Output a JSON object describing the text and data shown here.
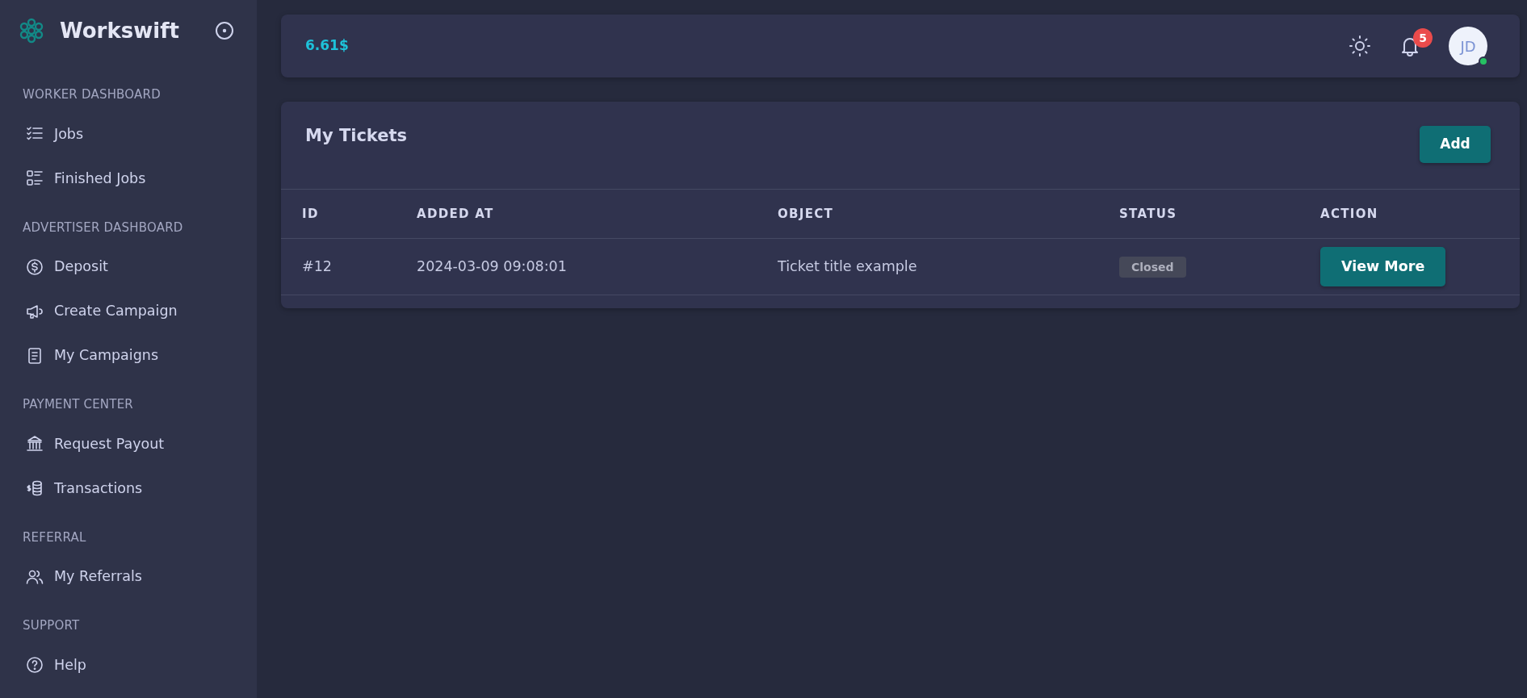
{
  "sidebar": {
    "brand": "Workswift",
    "sections": [
      {
        "title": "WORKER DASHBOARD",
        "items": [
          {
            "label": "Jobs",
            "selected": false
          },
          {
            "label": "Finished Jobs",
            "selected": false
          }
        ]
      },
      {
        "title": "ADVERTISER DASHBOARD",
        "items": [
          {
            "label": "Deposit",
            "selected": false
          },
          {
            "label": "Create Campaign",
            "selected": false
          },
          {
            "label": "My Campaigns",
            "selected": false
          }
        ]
      },
      {
        "title": "PAYMENT CENTER",
        "items": [
          {
            "label": "Request Payout",
            "selected": false
          },
          {
            "label": "Transactions",
            "selected": false
          }
        ]
      },
      {
        "title": "REFERRAL",
        "items": [
          {
            "label": "My Referrals",
            "selected": false
          }
        ]
      },
      {
        "title": "SUPPORT",
        "items": [
          {
            "label": "Help",
            "selected": false
          }
        ]
      }
    ]
  },
  "header": {
    "balance": "6.61$",
    "notifications": "5",
    "avatar": "JD",
    "online": true
  },
  "tickets": {
    "title": "My Tickets",
    "add_button": "Add",
    "columns": [
      "ID",
      "ADDED AT",
      "OBJECT",
      "STATUS",
      "ACTION"
    ],
    "rows": [
      {
        "id": "#12",
        "added_at": "2024-03-09 09:08:01",
        "object": "Ticket title example",
        "status": "Closed",
        "action": "View More"
      }
    ]
  }
}
